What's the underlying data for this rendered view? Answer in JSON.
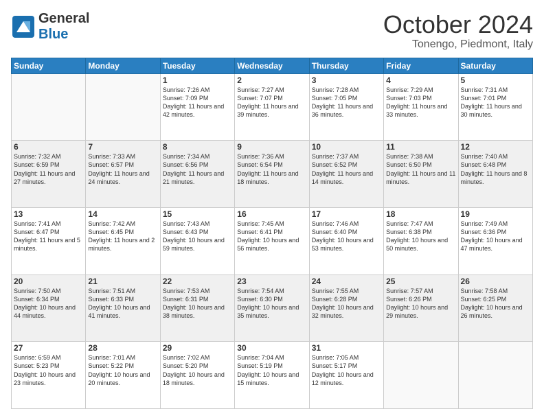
{
  "header": {
    "logo_general": "General",
    "logo_blue": "Blue",
    "month_title": "October 2024",
    "location": "Tonengo, Piedmont, Italy"
  },
  "days_of_week": [
    "Sunday",
    "Monday",
    "Tuesday",
    "Wednesday",
    "Thursday",
    "Friday",
    "Saturday"
  ],
  "weeks": [
    [
      {
        "day": "",
        "empty": true
      },
      {
        "day": "",
        "empty": true
      },
      {
        "day": "1",
        "sunrise": "Sunrise: 7:26 AM",
        "sunset": "Sunset: 7:09 PM",
        "daylight": "Daylight: 11 hours and 42 minutes."
      },
      {
        "day": "2",
        "sunrise": "Sunrise: 7:27 AM",
        "sunset": "Sunset: 7:07 PM",
        "daylight": "Daylight: 11 hours and 39 minutes."
      },
      {
        "day": "3",
        "sunrise": "Sunrise: 7:28 AM",
        "sunset": "Sunset: 7:05 PM",
        "daylight": "Daylight: 11 hours and 36 minutes."
      },
      {
        "day": "4",
        "sunrise": "Sunrise: 7:29 AM",
        "sunset": "Sunset: 7:03 PM",
        "daylight": "Daylight: 11 hours and 33 minutes."
      },
      {
        "day": "5",
        "sunrise": "Sunrise: 7:31 AM",
        "sunset": "Sunset: 7:01 PM",
        "daylight": "Daylight: 11 hours and 30 minutes."
      }
    ],
    [
      {
        "day": "6",
        "sunrise": "Sunrise: 7:32 AM",
        "sunset": "Sunset: 6:59 PM",
        "daylight": "Daylight: 11 hours and 27 minutes."
      },
      {
        "day": "7",
        "sunrise": "Sunrise: 7:33 AM",
        "sunset": "Sunset: 6:57 PM",
        "daylight": "Daylight: 11 hours and 24 minutes."
      },
      {
        "day": "8",
        "sunrise": "Sunrise: 7:34 AM",
        "sunset": "Sunset: 6:56 PM",
        "daylight": "Daylight: 11 hours and 21 minutes."
      },
      {
        "day": "9",
        "sunrise": "Sunrise: 7:36 AM",
        "sunset": "Sunset: 6:54 PM",
        "daylight": "Daylight: 11 hours and 18 minutes."
      },
      {
        "day": "10",
        "sunrise": "Sunrise: 7:37 AM",
        "sunset": "Sunset: 6:52 PM",
        "daylight": "Daylight: 11 hours and 14 minutes."
      },
      {
        "day": "11",
        "sunrise": "Sunrise: 7:38 AM",
        "sunset": "Sunset: 6:50 PM",
        "daylight": "Daylight: 11 hours and 11 minutes."
      },
      {
        "day": "12",
        "sunrise": "Sunrise: 7:40 AM",
        "sunset": "Sunset: 6:48 PM",
        "daylight": "Daylight: 11 hours and 8 minutes."
      }
    ],
    [
      {
        "day": "13",
        "sunrise": "Sunrise: 7:41 AM",
        "sunset": "Sunset: 6:47 PM",
        "daylight": "Daylight: 11 hours and 5 minutes."
      },
      {
        "day": "14",
        "sunrise": "Sunrise: 7:42 AM",
        "sunset": "Sunset: 6:45 PM",
        "daylight": "Daylight: 11 hours and 2 minutes."
      },
      {
        "day": "15",
        "sunrise": "Sunrise: 7:43 AM",
        "sunset": "Sunset: 6:43 PM",
        "daylight": "Daylight: 10 hours and 59 minutes."
      },
      {
        "day": "16",
        "sunrise": "Sunrise: 7:45 AM",
        "sunset": "Sunset: 6:41 PM",
        "daylight": "Daylight: 10 hours and 56 minutes."
      },
      {
        "day": "17",
        "sunrise": "Sunrise: 7:46 AM",
        "sunset": "Sunset: 6:40 PM",
        "daylight": "Daylight: 10 hours and 53 minutes."
      },
      {
        "day": "18",
        "sunrise": "Sunrise: 7:47 AM",
        "sunset": "Sunset: 6:38 PM",
        "daylight": "Daylight: 10 hours and 50 minutes."
      },
      {
        "day": "19",
        "sunrise": "Sunrise: 7:49 AM",
        "sunset": "Sunset: 6:36 PM",
        "daylight": "Daylight: 10 hours and 47 minutes."
      }
    ],
    [
      {
        "day": "20",
        "sunrise": "Sunrise: 7:50 AM",
        "sunset": "Sunset: 6:34 PM",
        "daylight": "Daylight: 10 hours and 44 minutes."
      },
      {
        "day": "21",
        "sunrise": "Sunrise: 7:51 AM",
        "sunset": "Sunset: 6:33 PM",
        "daylight": "Daylight: 10 hours and 41 minutes."
      },
      {
        "day": "22",
        "sunrise": "Sunrise: 7:53 AM",
        "sunset": "Sunset: 6:31 PM",
        "daylight": "Daylight: 10 hours and 38 minutes."
      },
      {
        "day": "23",
        "sunrise": "Sunrise: 7:54 AM",
        "sunset": "Sunset: 6:30 PM",
        "daylight": "Daylight: 10 hours and 35 minutes."
      },
      {
        "day": "24",
        "sunrise": "Sunrise: 7:55 AM",
        "sunset": "Sunset: 6:28 PM",
        "daylight": "Daylight: 10 hours and 32 minutes."
      },
      {
        "day": "25",
        "sunrise": "Sunrise: 7:57 AM",
        "sunset": "Sunset: 6:26 PM",
        "daylight": "Daylight: 10 hours and 29 minutes."
      },
      {
        "day": "26",
        "sunrise": "Sunrise: 7:58 AM",
        "sunset": "Sunset: 6:25 PM",
        "daylight": "Daylight: 10 hours and 26 minutes."
      }
    ],
    [
      {
        "day": "27",
        "sunrise": "Sunrise: 6:59 AM",
        "sunset": "Sunset: 5:23 PM",
        "daylight": "Daylight: 10 hours and 23 minutes."
      },
      {
        "day": "28",
        "sunrise": "Sunrise: 7:01 AM",
        "sunset": "Sunset: 5:22 PM",
        "daylight": "Daylight: 10 hours and 20 minutes."
      },
      {
        "day": "29",
        "sunrise": "Sunrise: 7:02 AM",
        "sunset": "Sunset: 5:20 PM",
        "daylight": "Daylight: 10 hours and 18 minutes."
      },
      {
        "day": "30",
        "sunrise": "Sunrise: 7:04 AM",
        "sunset": "Sunset: 5:19 PM",
        "daylight": "Daylight: 10 hours and 15 minutes."
      },
      {
        "day": "31",
        "sunrise": "Sunrise: 7:05 AM",
        "sunset": "Sunset: 5:17 PM",
        "daylight": "Daylight: 10 hours and 12 minutes."
      },
      {
        "day": "",
        "empty": true
      },
      {
        "day": "",
        "empty": true
      }
    ]
  ]
}
